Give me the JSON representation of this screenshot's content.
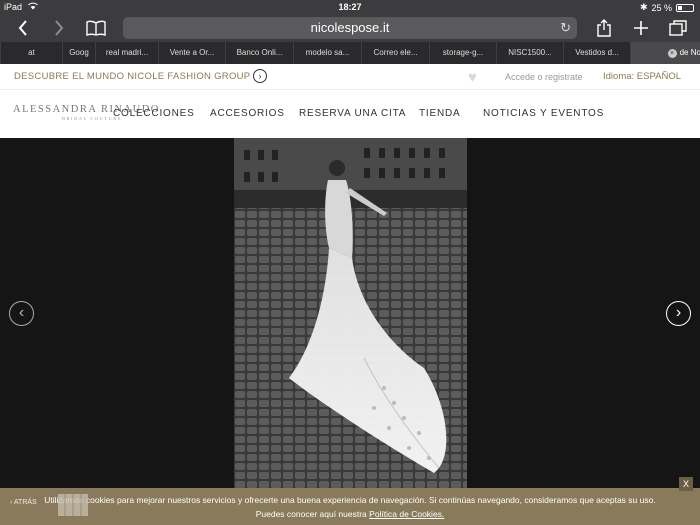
{
  "status": {
    "device": "iPad",
    "time": "18:27",
    "battery": "25 %"
  },
  "browser": {
    "url": "nicolespose.it",
    "tabs": [
      "at",
      "Goog",
      "real madri...",
      "Vente a Or...",
      "Banco Onli...",
      "modelo sa...",
      "Correo ele...",
      "storage-g...",
      "NISC1500...",
      "Vestidos d...",
      "de Novi..."
    ]
  },
  "site": {
    "discover": "DESCUBRE EL MUNDO NICOLE FASHION GROUP",
    "login": "Accede o registrate",
    "language_label": "Idioma:",
    "language_value": "ESPAÑOL",
    "logo": "ALESSANDRA RINAUDO",
    "logo_sub": "BRIDAL COUTURE",
    "nav": [
      "COLECCIONES",
      "ACCESORIOS",
      "RESERVA UNA CITA",
      "TIENDA",
      "NOTICIAS Y EVENTOS"
    ]
  },
  "cookie": {
    "line1": "Utilizamos cookies para mejorar nuestros servicios y ofrecerte una buena experiencia de navegación. Si continúas navegando, consideramos que aceptas su uso.",
    "line2_prefix": "Puedes conocer aquí nuestra",
    "link": "Política de Cookies.",
    "close": "X",
    "back": "ATRÁS"
  },
  "icons": {
    "back": "chevron-left-icon",
    "forward": "chevron-right-icon",
    "bookmarks": "book-icon",
    "reload": "reload-icon",
    "share": "share-icon",
    "new-tab": "plus-icon",
    "tabs": "tabs-icon"
  }
}
